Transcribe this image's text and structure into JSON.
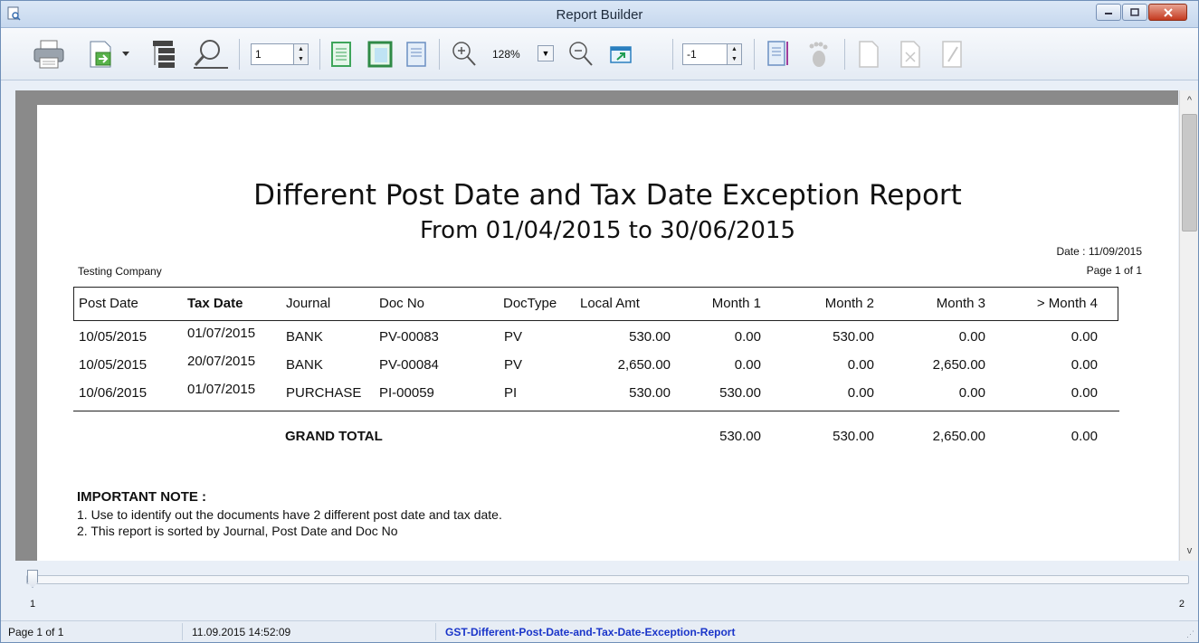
{
  "window": {
    "title": "Report Builder"
  },
  "toolbar": {
    "page_value": "1",
    "zoom_value": "128%",
    "offset_value": "-1"
  },
  "report": {
    "title": "Different Post Date and Tax Date Exception Report",
    "subtitle": "From 01/04/2015 to 30/06/2015",
    "date_line": "Date :  11/09/2015",
    "page_line": "Page 1 of 1",
    "company": "Testing Company",
    "columns": [
      "Post Date",
      "Tax Date",
      "Journal",
      "Doc No",
      "DocType",
      "Local Amt",
      "Month 1",
      "Month 2",
      "Month 3",
      "> Month 4"
    ],
    "rows": [
      [
        "10/05/2015",
        "01/07/2015",
        "BANK",
        "PV-00083",
        "PV",
        "530.00",
        "0.00",
        "530.00",
        "0.00",
        "0.00"
      ],
      [
        "10/05/2015",
        "20/07/2015",
        "BANK",
        "PV-00084",
        "PV",
        "2,650.00",
        "0.00",
        "0.00",
        "2,650.00",
        "0.00"
      ],
      [
        "10/06/2015",
        "01/07/2015",
        "PURCHASE",
        "PI-00059",
        "PI",
        "530.00",
        "530.00",
        "0.00",
        "0.00",
        "0.00"
      ]
    ],
    "grand_total_label": "GRAND TOTAL",
    "grand_total": [
      "530.00",
      "530.00",
      "2,650.00",
      "0.00"
    ],
    "note_title": "IMPORTANT NOTE :",
    "notes": [
      "1. Use to identify out the documents have 2 different post date and tax date.",
      "2. This report is sorted by Journal, Post Date and Doc No"
    ]
  },
  "slider": {
    "min_label": "1",
    "max_label": "2"
  },
  "status": {
    "page": "Page 1 of 1",
    "timestamp": "11.09.2015 14:52:09",
    "report_name": "GST-Different-Post-Date-and-Tax-Date-Exception-Report"
  }
}
